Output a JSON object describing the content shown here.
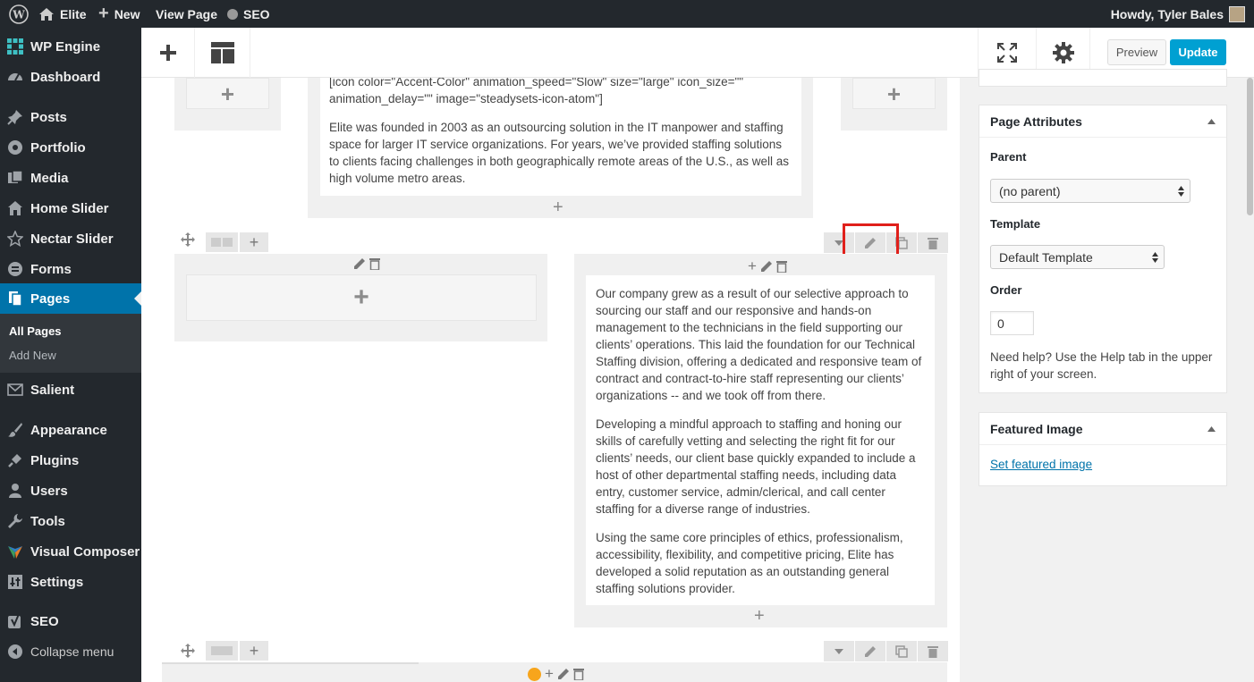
{
  "admin_bar": {
    "site_name": "Elite",
    "new_label": "New",
    "view_page_label": "View Page",
    "seo_label": "SEO",
    "greeting": "Howdy, Tyler Bales"
  },
  "sidebar": {
    "items": [
      {
        "label": "WP Engine",
        "icon": "wpengine-icon"
      },
      {
        "label": "Dashboard",
        "icon": "dashboard-icon"
      },
      {
        "label": "Posts",
        "icon": "pin-icon"
      },
      {
        "label": "Portfolio",
        "icon": "portfolio-icon"
      },
      {
        "label": "Media",
        "icon": "media-icon"
      },
      {
        "label": "Home Slider",
        "icon": "home-icon"
      },
      {
        "label": "Nectar Slider",
        "icon": "star-icon"
      },
      {
        "label": "Forms",
        "icon": "forms-icon"
      },
      {
        "label": "Pages",
        "icon": "pages-icon"
      },
      {
        "label": "Salient",
        "icon": "mail-icon"
      },
      {
        "label": "Appearance",
        "icon": "brush-icon"
      },
      {
        "label": "Plugins",
        "icon": "plug-icon"
      },
      {
        "label": "Users",
        "icon": "user-icon"
      },
      {
        "label": "Tools",
        "icon": "wrench-icon"
      },
      {
        "label": "Visual Composer",
        "icon": "vc-icon"
      },
      {
        "label": "Settings",
        "icon": "settings-icon"
      },
      {
        "label": "SEO",
        "icon": "yoast-icon"
      },
      {
        "label": "Collapse menu",
        "icon": "collapse-icon"
      }
    ],
    "submenu": {
      "all_pages": "All Pages",
      "add_new": "Add New"
    }
  },
  "toolbar": {
    "preview_label": "Preview",
    "update_label": "Update"
  },
  "editor": {
    "shortcode_line1": "[icon color=\"Accent-Color\" animation_speed=\"Slow\" size=\"large\" icon_size=\"\"",
    "shortcode_line2": "animation_delay=\"\" image=\"steadysets-icon-atom\"]",
    "paragraph_top": "Elite was founded in 2003 as an outsourcing solution in the IT manpower and staffing space for larger IT service organizations. For years, we’ve provided staffing solutions to clients facing challenges in both geographically remote areas of the U.S., as well as high volume metro areas.",
    "paragraph_1": "Our company grew as a result of our selective approach to sourcing our staff and our responsive and hands-on management to the technicians in the field supporting our clients’ operations. This laid the foundation for our Technical Staffing division, offering a dedicated and responsive team of contract and contract-to-hire staff representing our clients’ organizations -- and we took off from there.",
    "paragraph_2": "Developing a mindful approach to staffing and honing our skills of carefully vetting and selecting the right fit for our clients’ needs, our client base quickly expanded to include a host of other departmental staffing needs, including data entry, customer service, admin/clerical, and call center staffing for a diverse range of industries.",
    "paragraph_3": "Using the same core principles of ethics, professionalism, accessibility, flexibility, and competitive pricing, Elite has developed a solid reputation as an outstanding general staffing solutions provider."
  },
  "page_attributes": {
    "title": "Page Attributes",
    "parent_label": "Parent",
    "parent_value": "(no parent)",
    "template_label": "Template",
    "template_value": "Default Template",
    "order_label": "Order",
    "order_value": "0",
    "help_text": "Need help? Use the Help tab in the upper right of your screen."
  },
  "featured_image": {
    "title": "Featured Image",
    "link": "Set featured image"
  },
  "colors": {
    "admin_dark": "#23282d",
    "accent_blue": "#0073aa",
    "update_blue": "#00a0d2",
    "highlight_red": "#e0201b",
    "vc_orange": "#f7a51c"
  }
}
